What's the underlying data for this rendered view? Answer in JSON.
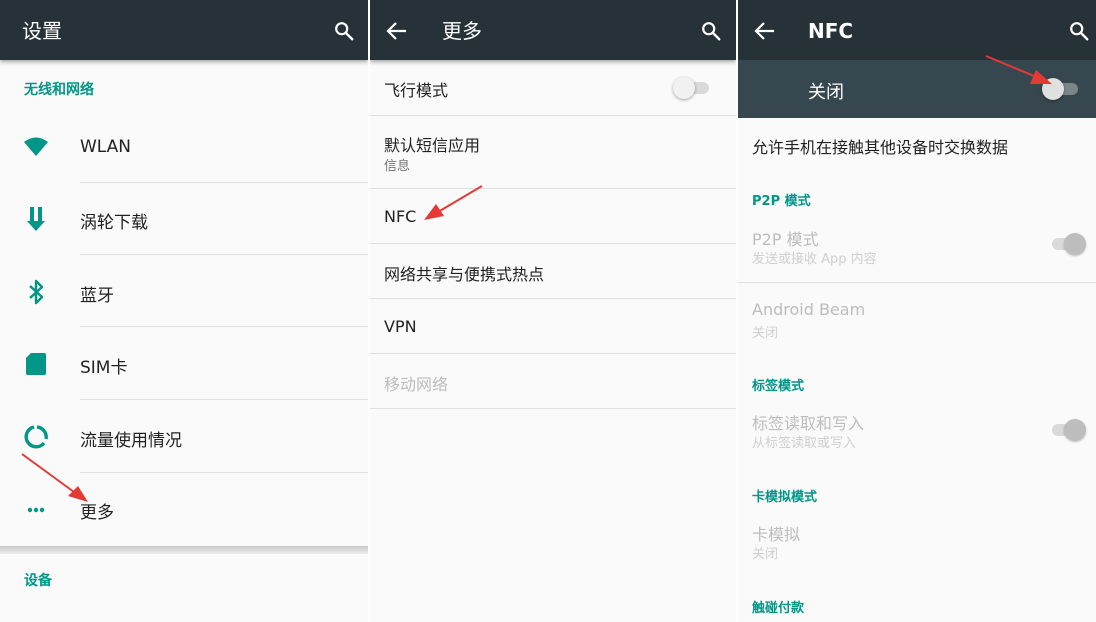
{
  "settings": {
    "title": "设置",
    "section_wireless": "无线和网络",
    "items": [
      {
        "label": "WLAN",
        "icon": "wifi-icon"
      },
      {
        "label": "涡轮下载",
        "icon": "download-arrow-icon"
      },
      {
        "label": "蓝牙",
        "icon": "bluetooth-icon"
      },
      {
        "label": "SIM卡",
        "icon": "sim-card-icon"
      },
      {
        "label": "流量使用情况",
        "icon": "data-usage-icon"
      },
      {
        "label": "更多",
        "icon": "more-dots-icon"
      }
    ],
    "section_device": "设备"
  },
  "more": {
    "title": "更多",
    "airplane_mode": {
      "label": "飞行模式",
      "enabled": false
    },
    "default_sms": {
      "label": "默认短信应用",
      "sub": "信息"
    },
    "nfc": {
      "label": "NFC"
    },
    "hotspot": {
      "label": "网络共享与便携式热点"
    },
    "vpn": {
      "label": "VPN"
    },
    "mobile_network": {
      "label": "移动网络"
    }
  },
  "nfc": {
    "title": "NFC",
    "status_label": "关闭",
    "status_enabled": false,
    "description": "允许手机在接触其他设备时交换数据",
    "p2p_section": "P2P 模式",
    "p2p_item": {
      "label": "P2P 模式",
      "sub": "发送或接收 App 内容",
      "enabled": true
    },
    "beam": {
      "label": "Android Beam",
      "sub": "关闭"
    },
    "tag_section": "标签模式",
    "tag_item": {
      "label": "标签读取和写入",
      "sub": "从标签读取或写入",
      "enabled": true
    },
    "card_section": "卡模拟模式",
    "card_item": {
      "label": "卡模拟",
      "sub": "关闭"
    },
    "touch_pay_section": "触碰付款"
  },
  "colors": {
    "toolbar": "#263238",
    "accent": "#009688",
    "annotation_arrow": "#e53935"
  }
}
